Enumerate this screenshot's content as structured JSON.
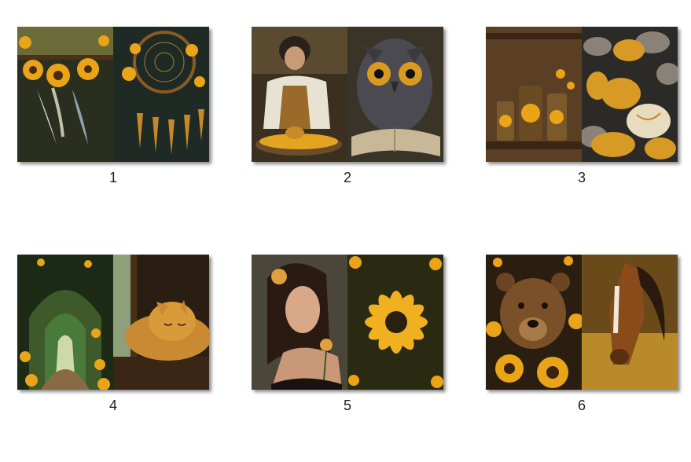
{
  "gallery": {
    "items": [
      {
        "caption": "1",
        "left_image": "sunflower-dreamcatcher-feathers-icon",
        "right_image": "dreamcatcher-sunflowers-icon"
      },
      {
        "caption": "2",
        "left_image": "woman-potter-icon",
        "right_image": "owl-book-icon"
      },
      {
        "caption": "3",
        "left_image": "sunflower-jars-shelf-icon",
        "right_image": "golden-stones-icon"
      },
      {
        "caption": "4",
        "left_image": "sunflower-garden-arch-icon",
        "right_image": "sleeping-cat-window-icon"
      },
      {
        "caption": "5",
        "left_image": "woman-with-rose-icon",
        "right_image": "yellow-flower-closeup-icon"
      },
      {
        "caption": "6",
        "left_image": "bear-sunflowers-icon",
        "right_image": "horse-golden-field-icon"
      }
    ]
  },
  "colors": {
    "gold": "#e9a417",
    "dark": "#1e1b12",
    "brown": "#6b4419"
  }
}
